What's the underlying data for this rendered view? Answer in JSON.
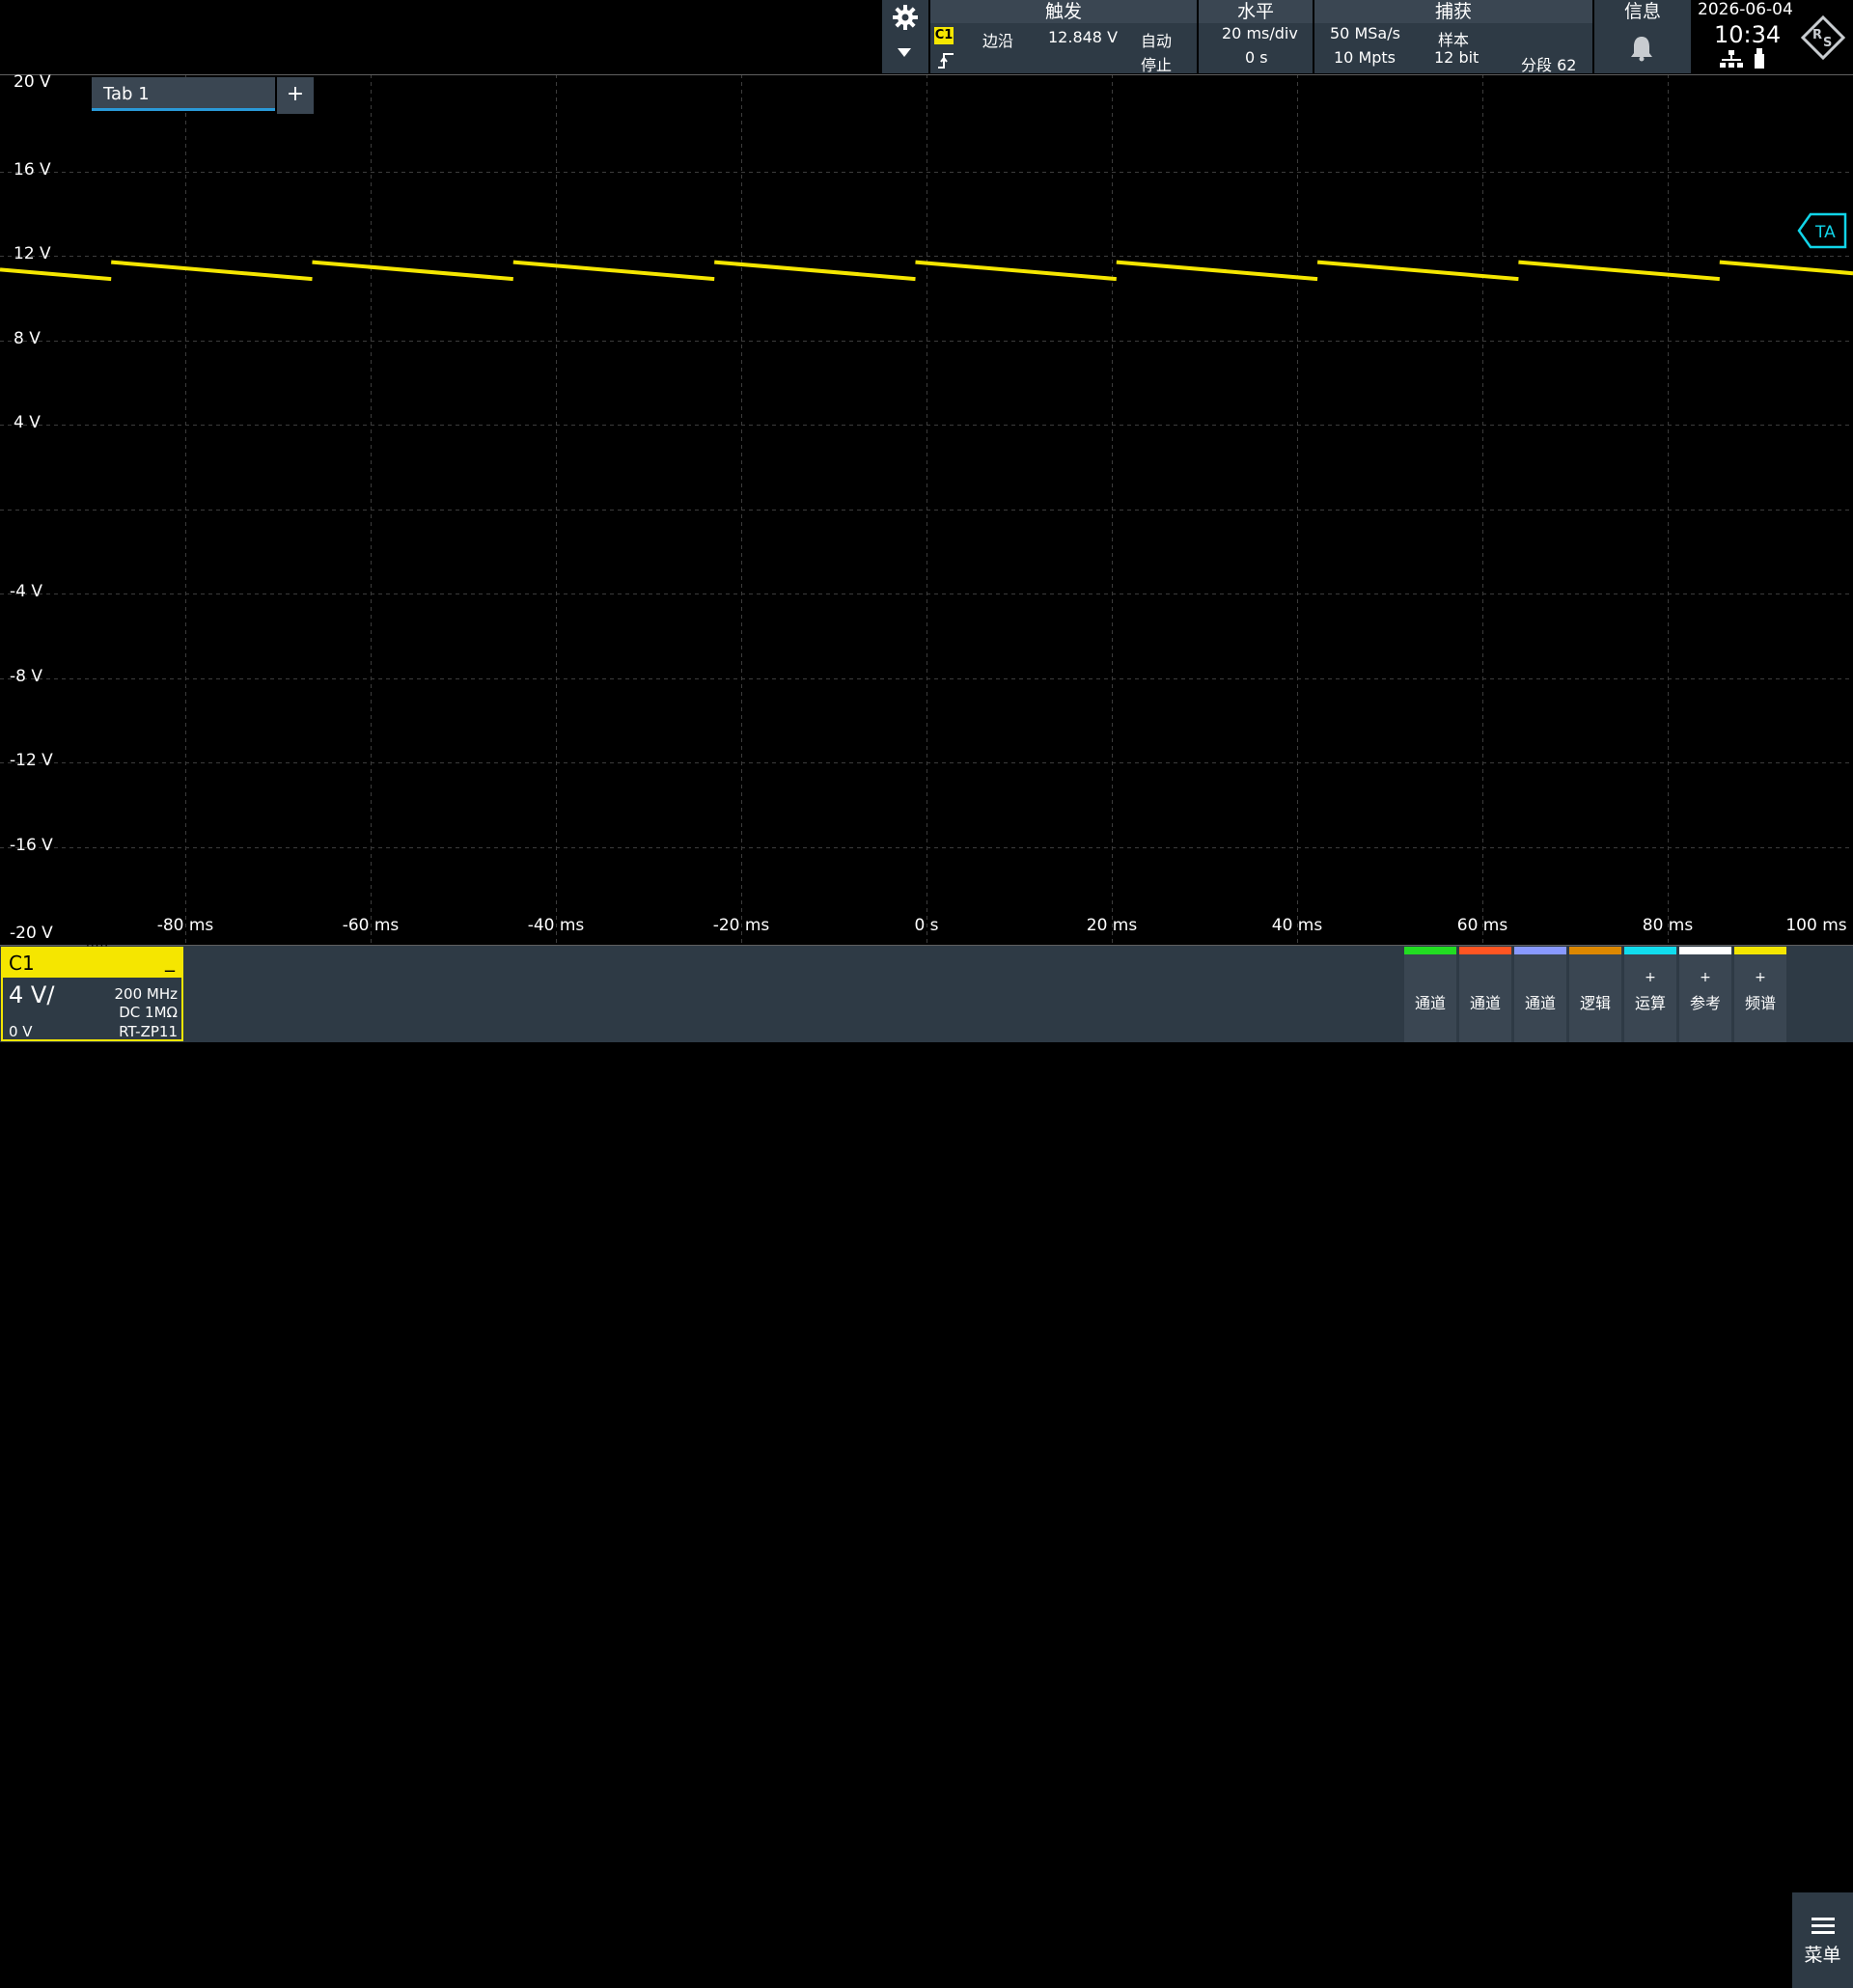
{
  "trigger": {
    "title": "触发",
    "channel": "C1",
    "type": "边沿",
    "level": "12.848 V",
    "mode": "自动",
    "state": "停止"
  },
  "horizontal": {
    "title": "水平",
    "scale": "20 ms/div",
    "position": "0 s"
  },
  "acquisition": {
    "title": "捕获",
    "sample_rate": "50 MSa/s",
    "mode": "样本",
    "record_length": "10 Mpts",
    "resolution": "12 bit",
    "segment": "分段 62"
  },
  "info": {
    "title": "信息"
  },
  "datetime": {
    "date": "2026-06-04",
    "time": "10:34"
  },
  "tabs": {
    "tab1": "Tab 1",
    "add": "+"
  },
  "marker": {
    "label": "TA"
  },
  "y_axis": {
    "labels": [
      "20 V",
      "16 V",
      "12 V",
      "8 V",
      "4 V",
      "-4 V",
      "-8 V",
      "-12 V",
      "-16 V",
      "-20 V"
    ]
  },
  "x_axis": {
    "labels": [
      "-80 ms",
      "-60 ms",
      "-40 ms",
      "-20 ms",
      "0 s",
      "20 ms",
      "40 ms",
      "60 ms",
      "80 ms",
      "100 ms"
    ]
  },
  "channel": {
    "name": "C1",
    "scale": "4 V/",
    "bandwidth": "200 MHz",
    "coupling": "DC 1MΩ",
    "offset": "0 V",
    "probe": "RT-ZP11",
    "color": "#f5e600"
  },
  "bottom_buttons": [
    {
      "label": "通道",
      "plus": "",
      "color": "#22dd22"
    },
    {
      "label": "通道",
      "plus": "",
      "color": "#ff5522"
    },
    {
      "label": "通道",
      "plus": "",
      "color": "#8899ff"
    },
    {
      "label": "逻辑",
      "plus": "",
      "color": "#dd8800"
    },
    {
      "label": "运算",
      "plus": "+",
      "color": "#11ddee"
    },
    {
      "label": "参考",
      "plus": "+",
      "color": "#ffffff"
    },
    {
      "label": "频谱",
      "plus": "+",
      "color": "#f5e600"
    }
  ],
  "menu": {
    "label": "菜单"
  },
  "chart_data": {
    "type": "line",
    "title": "",
    "xlabel": "",
    "ylabel": "",
    "xlim": [
      -100,
      100
    ],
    "ylim": [
      -20,
      20
    ],
    "x_unit": "ms",
    "y_unit": "V",
    "grid": true,
    "series": [
      {
        "color": "#f5e600",
        "waveform": "sawtooth",
        "period_ms": 21.7,
        "max_v": 11.7,
        "min_v": 10.9,
        "first_jump_ms": -88
      }
    ]
  }
}
